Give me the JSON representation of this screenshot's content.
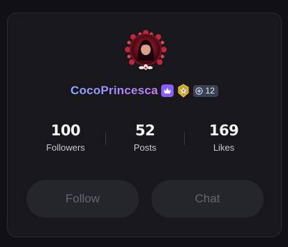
{
  "profile": {
    "username": "CocoPrincesca",
    "badges": {
      "crown_icon": "crown-icon",
      "medal_icon": "medal-icon",
      "level_icon": "plus-circle-icon",
      "level_value": "12"
    }
  },
  "stats": [
    {
      "value": "100",
      "label": "Followers"
    },
    {
      "value": "52",
      "label": "Posts"
    },
    {
      "value": "169",
      "label": "Likes"
    }
  ],
  "actions": {
    "follow_label": "Follow",
    "chat_label": "Chat"
  },
  "colors": {
    "background": "#111115",
    "card": "#18181c",
    "button": "#25252c",
    "username_gradient_start": "#8fa8ff",
    "username_gradient_end": "#c77dff",
    "crown_badge": "#8b5cf6"
  }
}
